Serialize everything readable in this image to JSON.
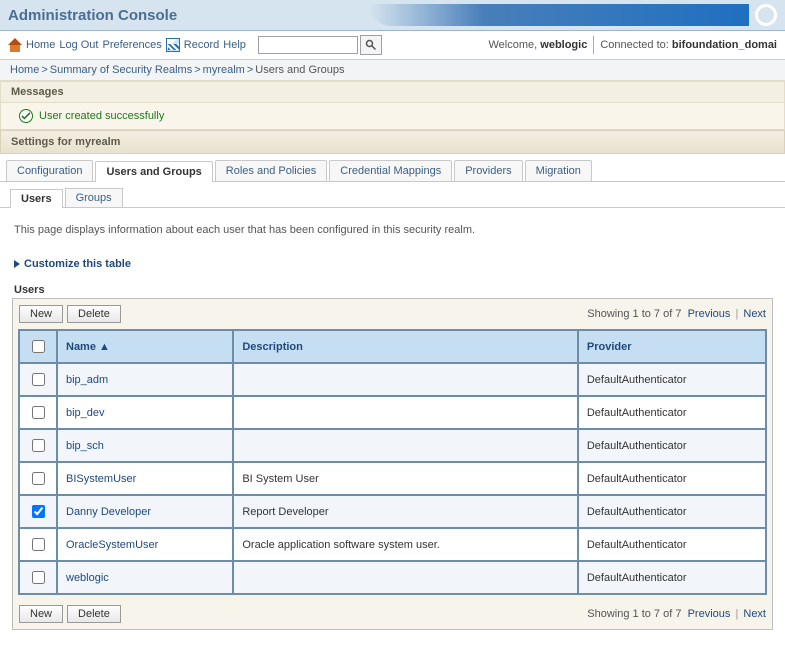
{
  "title": "Administration Console",
  "toolbar": {
    "home": "Home",
    "logout": "Log Out",
    "prefs": "Preferences",
    "record": "Record",
    "help": "Help"
  },
  "search": {
    "placeholder": ""
  },
  "welcome": {
    "label": "Welcome,",
    "user": "weblogic"
  },
  "connection": {
    "label": "Connected to:",
    "value": "bifoundation_domai"
  },
  "breadcrumbs": {
    "items": [
      "Home",
      "Summary of Security Realms",
      "myrealm",
      "Users and Groups"
    ]
  },
  "messages": {
    "header": "Messages",
    "success": "User created successfully"
  },
  "settings_header": "Settings for myrealm",
  "tabs": [
    "Configuration",
    "Users and Groups",
    "Roles and Policies",
    "Credential Mappings",
    "Providers",
    "Migration"
  ],
  "active_tab": 1,
  "subtabs": [
    "Users",
    "Groups"
  ],
  "active_subtab": 0,
  "page_description": "This page displays information about each user that has been configured in this security realm.",
  "customize": "Customize this table",
  "table_title": "Users",
  "buttons": {
    "new": "New",
    "delete": "Delete"
  },
  "paging": {
    "summary": "Showing 1 to 7 of 7",
    "prev": "Previous",
    "next": "Next"
  },
  "columns": {
    "name": "Name",
    "description": "Description",
    "provider": "Provider"
  },
  "rows": [
    {
      "name": "bip_adm",
      "description": "",
      "provider": "DefaultAuthenticator",
      "checked": false
    },
    {
      "name": "bip_dev",
      "description": "",
      "provider": "DefaultAuthenticator",
      "checked": false
    },
    {
      "name": "bip_sch",
      "description": "",
      "provider": "DefaultAuthenticator",
      "checked": false
    },
    {
      "name": "BISystemUser",
      "description": "BI System User",
      "provider": "DefaultAuthenticator",
      "checked": false
    },
    {
      "name": "Danny Developer",
      "description": "Report Developer",
      "provider": "DefaultAuthenticator",
      "checked": true
    },
    {
      "name": "OracleSystemUser",
      "description": "Oracle application software system user.",
      "provider": "DefaultAuthenticator",
      "checked": false
    },
    {
      "name": "weblogic",
      "description": "",
      "provider": "DefaultAuthenticator",
      "checked": false
    }
  ]
}
